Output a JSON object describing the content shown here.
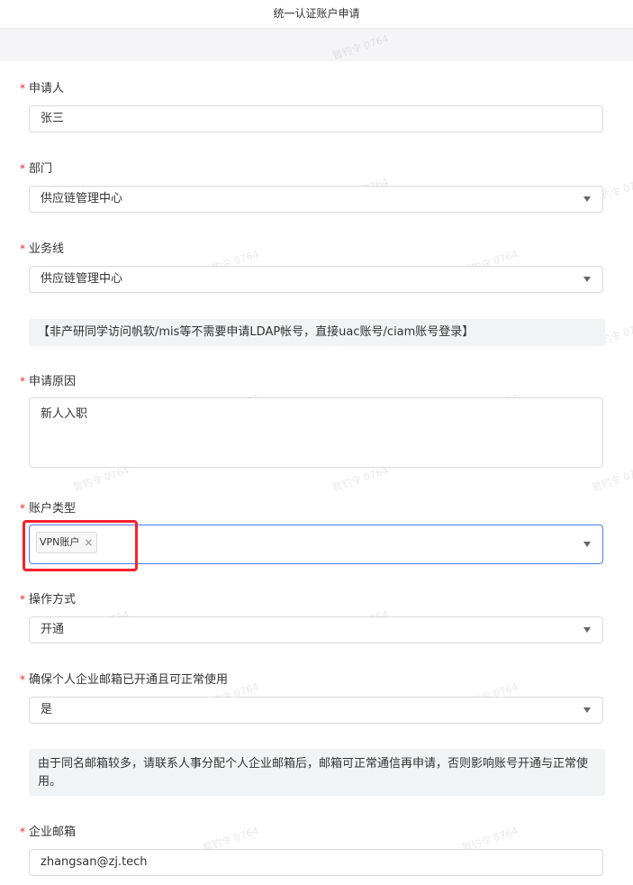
{
  "header": {
    "title": "统一认证账户申请"
  },
  "watermark": "暂钓令 0764",
  "form": {
    "applicant": {
      "label": "申请人",
      "value": "张三"
    },
    "department": {
      "label": "部门",
      "value": "供应链管理中心"
    },
    "business_line": {
      "label": "业务线",
      "value": "供应链管理中心"
    },
    "ldap_notice": "【非产研同学访问帆软/mis等不需要申请LDAP帐号，直接uac账号/ciam账号登录】",
    "reason": {
      "label": "申请原因",
      "value": "新人入职"
    },
    "account_type": {
      "label": "账户类型",
      "tags": [
        "VPN账户"
      ],
      "remove_glyph": "×"
    },
    "operation": {
      "label": "操作方式",
      "value": "开通"
    },
    "email_confirm": {
      "label": "确保个人企业邮箱已开通且可正常使用",
      "value": "是"
    },
    "email_notice": "由于同名邮箱较多，请联系人事分配个人企业邮箱后，邮箱可正常通信再申请，否则影响账号开通与正常使用。",
    "email": {
      "label": "企业邮箱",
      "value": "zhangsan@zj.tech"
    },
    "required_mark": "*"
  },
  "colors": {
    "required": "#f5222d",
    "focus_border": "#4a7cf0",
    "highlight": "#f5222d"
  }
}
